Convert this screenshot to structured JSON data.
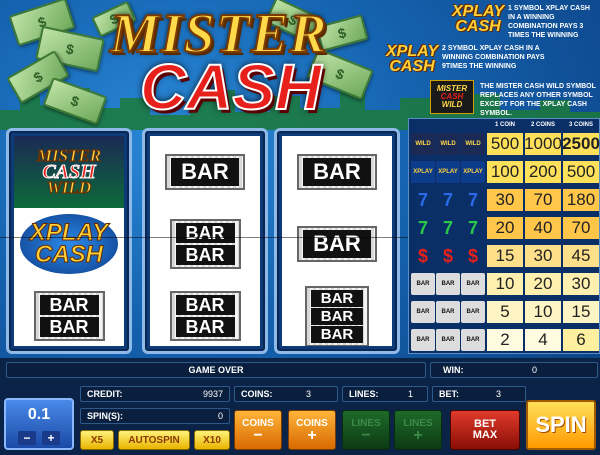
{
  "logo": {
    "line1": "MISTER",
    "line2": "CASH"
  },
  "info": {
    "symbol_one_logo": "XPLAY\nCASH",
    "symbol_one_text": "1 SYMBOL XPLAY CASH IN A WINNING COMBINATION PAYS 3 TIMES THE WINNING",
    "symbol_two_logo": "XPLAY\nCASH",
    "symbol_two_text": "2 SYMBOL XPLAY CASH IN A WINNING COMBINATION PAYS 9TIMES THE WINNING",
    "wild_text": "THE MISTER CASH WILD SYMBOL REPLACES ANY OTHER SYMBOL EXCEPT FOR THE XPLAY CASH SYMBOL."
  },
  "reels": [
    [
      "MISTER CASH WILD",
      "XPLAY CASH",
      "BAR BAR"
    ],
    [
      "BAR",
      "BAR BAR",
      "BAR BAR"
    ],
    [
      "BAR",
      "BAR",
      "BAR BAR BAR"
    ]
  ],
  "paytable": {
    "headers": [
      "1 COIN",
      "2 COINS",
      "3 COINS"
    ],
    "rows": [
      {
        "symbol": "wild",
        "values": [
          "500",
          "1000",
          "2500"
        ]
      },
      {
        "symbol": "xplay",
        "values": [
          "100",
          "200",
          "500"
        ]
      },
      {
        "symbol": "seven-blue",
        "values": [
          "30",
          "70",
          "180"
        ]
      },
      {
        "symbol": "seven-green",
        "values": [
          "20",
          "40",
          "70"
        ]
      },
      {
        "symbol": "dollar",
        "values": [
          "15",
          "30",
          "45"
        ]
      },
      {
        "symbol": "bar3",
        "values": [
          "10",
          "20",
          "30"
        ]
      },
      {
        "symbol": "bar2",
        "values": [
          "5",
          "10",
          "15"
        ]
      },
      {
        "symbol": "bar1",
        "values": [
          "2",
          "4",
          "6"
        ]
      }
    ]
  },
  "status": {
    "message": "GAME OVER",
    "win_label": "WIN:",
    "win_value": "0",
    "credit_label": "CREDIT:",
    "credit_value": "9937",
    "coins_label": "COINS:",
    "coins_value": "3",
    "lines_label": "LINES:",
    "lines_value": "1",
    "bet_label": "BET:",
    "bet_value": "3",
    "spins_label": "SPIN(S):",
    "spins_value": "0"
  },
  "controls": {
    "denomination": "0.1",
    "x5": "X5",
    "autospin": "AUTOSPIN",
    "x10": "X10",
    "coins_minus": "COINS",
    "coins_plus": "COINS",
    "lines_minus": "LINES",
    "lines_plus": "LINES",
    "bet_max_1": "BET",
    "bet_max_2": "MAX",
    "spin": "SPIN"
  },
  "colors": {
    "accent": "#ff9a00",
    "reel_frame": "#8eb9e8",
    "paytable_highlight": "#ffe05a"
  }
}
